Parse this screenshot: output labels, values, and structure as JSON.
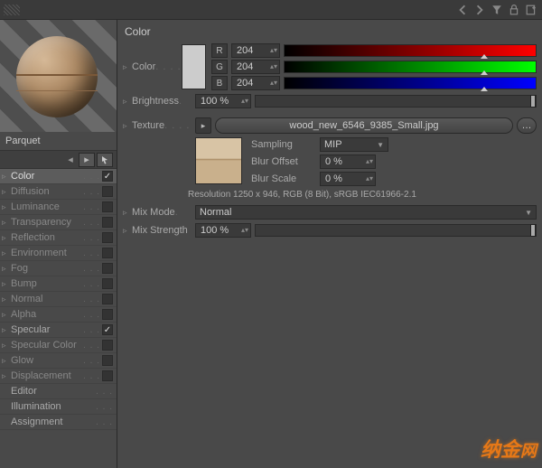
{
  "toolbar_icons": [
    "prev-icon",
    "next-icon",
    "funnel-icon",
    "lock-icon",
    "plus-icon"
  ],
  "material_name": "Parquet",
  "channels": [
    {
      "label": "Color",
      "checked": true,
      "selected": true,
      "expandable": true,
      "dim": false
    },
    {
      "label": "Diffusion",
      "checked": false,
      "expandable": true,
      "dim": true
    },
    {
      "label": "Luminance",
      "checked": false,
      "expandable": true,
      "dim": true
    },
    {
      "label": "Transparency",
      "checked": false,
      "expandable": true,
      "dim": true
    },
    {
      "label": "Reflection",
      "checked": false,
      "expandable": true,
      "dim": true
    },
    {
      "label": "Environment",
      "checked": false,
      "expandable": true,
      "dim": true
    },
    {
      "label": "Fog",
      "checked": false,
      "expandable": true,
      "dim": true
    },
    {
      "label": "Bump",
      "checked": false,
      "expandable": true,
      "dim": true
    },
    {
      "label": "Normal",
      "checked": false,
      "expandable": true,
      "dim": true
    },
    {
      "label": "Alpha",
      "checked": false,
      "expandable": true,
      "dim": true
    },
    {
      "label": "Specular",
      "checked": true,
      "expandable": true,
      "dim": false
    },
    {
      "label": "Specular Color",
      "checked": false,
      "expandable": true,
      "dim": true
    },
    {
      "label": "Glow",
      "checked": false,
      "expandable": true,
      "dim": true
    },
    {
      "label": "Displacement",
      "checked": false,
      "expandable": true,
      "dim": true
    },
    {
      "label": "Editor",
      "checked": null,
      "expandable": false,
      "dim": false
    },
    {
      "label": "Illumination",
      "checked": null,
      "expandable": false,
      "dim": false
    },
    {
      "label": "Assignment",
      "checked": null,
      "expandable": false,
      "dim": false
    }
  ],
  "panel": {
    "title": "Color",
    "color_label": "Color",
    "rgb": {
      "r_label": "R",
      "g_label": "G",
      "b_label": "B",
      "r": "204",
      "g": "204",
      "b": "204"
    },
    "swatch_hex": "#cccccc",
    "brightness_label": "Brightness",
    "brightness": "100 %",
    "texture_label": "Texture",
    "texture_file": "wood_new_6546_9385_Small.jpg",
    "sampling_label": "Sampling",
    "sampling_value": "MIP",
    "blur_offset_label": "Blur Offset",
    "blur_offset": "0 %",
    "blur_scale_label": "Blur Scale",
    "blur_scale": "0 %",
    "resolution": "Resolution 1250 x 946, RGB (8 Bit), sRGB IEC61966-2.1",
    "mix_mode_label": "Mix Mode",
    "mix_mode_value": "Normal",
    "mix_strength_label": "Mix Strength",
    "mix_strength": "100 %"
  },
  "watermark": "纳金网"
}
